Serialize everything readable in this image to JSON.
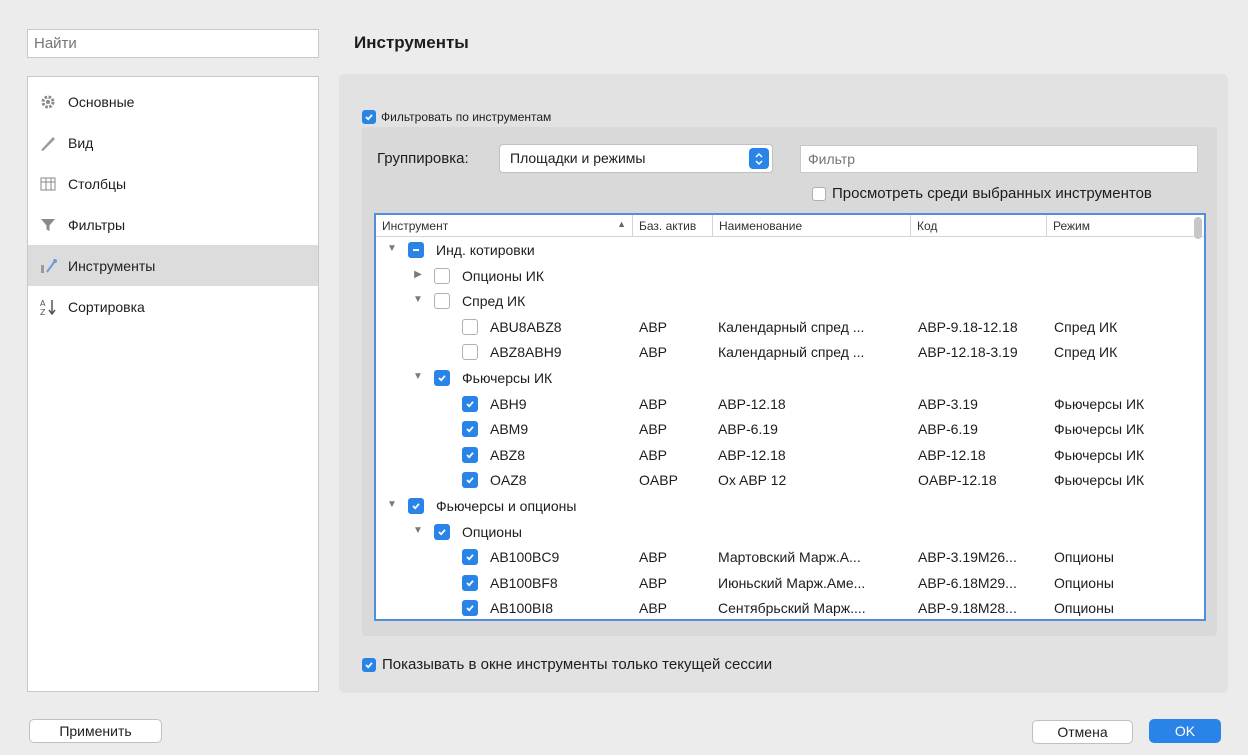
{
  "search": {
    "placeholder": "Найти"
  },
  "sidebar": {
    "items": [
      {
        "label": "Основные",
        "icon": "gear-icon"
      },
      {
        "label": "Вид",
        "icon": "brush-icon"
      },
      {
        "label": "Столбцы",
        "icon": "columns-icon"
      },
      {
        "label": "Фильтры",
        "icon": "funnel-icon"
      },
      {
        "label": "Инструменты",
        "icon": "tools-icon"
      },
      {
        "label": "Сортировка",
        "icon": "sort-icon"
      }
    ]
  },
  "page": {
    "title": "Инструменты"
  },
  "filter_instruments": {
    "label": "Фильтровать по инструментам",
    "checked": true
  },
  "grouping": {
    "label": "Группировка:",
    "value": "Площадки и режимы"
  },
  "filter": {
    "placeholder": "Фильтр"
  },
  "view_selected": {
    "label": "Просмотреть среди выбранных инструментов",
    "checked": false
  },
  "table": {
    "columns": [
      "Инструмент",
      "Баз. актив",
      "Наименование",
      "Код",
      "Режим"
    ],
    "rows": [
      {
        "level": 0,
        "expand": "open",
        "check": "mixed",
        "name": "Инд. котировки"
      },
      {
        "level": 1,
        "expand": "closed",
        "check": "off",
        "name": "Опционы ИК"
      },
      {
        "level": 1,
        "expand": "open",
        "check": "off",
        "name": "Спред ИК"
      },
      {
        "level": 2,
        "check": "off",
        "name": "ABU8ABZ8",
        "base": "ABP",
        "title": "Календарный спред ...",
        "code": "ABP-9.18-12.18",
        "mode": "Спред ИК"
      },
      {
        "level": 2,
        "check": "off",
        "name": "ABZ8ABH9",
        "base": "ABP",
        "title": "Календарный спред ...",
        "code": "ABP-12.18-3.19",
        "mode": "Спред ИК"
      },
      {
        "level": 1,
        "expand": "open",
        "check": "on",
        "name": "Фьючерсы ИК"
      },
      {
        "level": 2,
        "check": "on",
        "name": "ABH9",
        "base": "ABP",
        "title": "ABP-12.18",
        "code": "ABP-3.19",
        "mode": "Фьючерсы ИК"
      },
      {
        "level": 2,
        "check": "on",
        "name": "ABM9",
        "base": "ABP",
        "title": "ABP-6.19",
        "code": "ABP-6.19",
        "mode": "Фьючерсы ИК"
      },
      {
        "level": 2,
        "check": "on",
        "name": "ABZ8",
        "base": "ABP",
        "title": "ABP-12.18",
        "code": "ABP-12.18",
        "mode": "Фьючерсы ИК"
      },
      {
        "level": 2,
        "check": "on",
        "name": "OAZ8",
        "base": "OABP",
        "title": "Ox ABP 12",
        "code": "OABP-12.18",
        "mode": "Фьючерсы ИК"
      },
      {
        "level": 0,
        "expand": "open",
        "check": "on",
        "name": "Фьючерсы и опционы"
      },
      {
        "level": 1,
        "expand": "open",
        "check": "on",
        "name": "Опционы"
      },
      {
        "level": 2,
        "check": "on",
        "name": "AB100BC9",
        "base": "ABP",
        "title": "Мартовский Марж.А...",
        "code": "ABP-3.19M26...",
        "mode": "Опционы"
      },
      {
        "level": 2,
        "check": "on",
        "name": "AB100BF8",
        "base": "ABP",
        "title": "Июньский Марж.Аме...",
        "code": "ABP-6.18M29...",
        "mode": "Опционы"
      },
      {
        "level": 2,
        "check": "on",
        "name": "AB100BI8",
        "base": "ABP",
        "title": "Сентябрьский Марж....",
        "code": "ABP-9.18M28...",
        "mode": "Опционы"
      }
    ]
  },
  "session": {
    "label": "Показывать в окне инструменты только текущей сессии",
    "checked": true
  },
  "buttons": {
    "apply": "Применить",
    "cancel": "Отмена",
    "ok": "OK"
  },
  "colors": {
    "accent": "#2a84e8",
    "selection": "#dcdcdc"
  }
}
